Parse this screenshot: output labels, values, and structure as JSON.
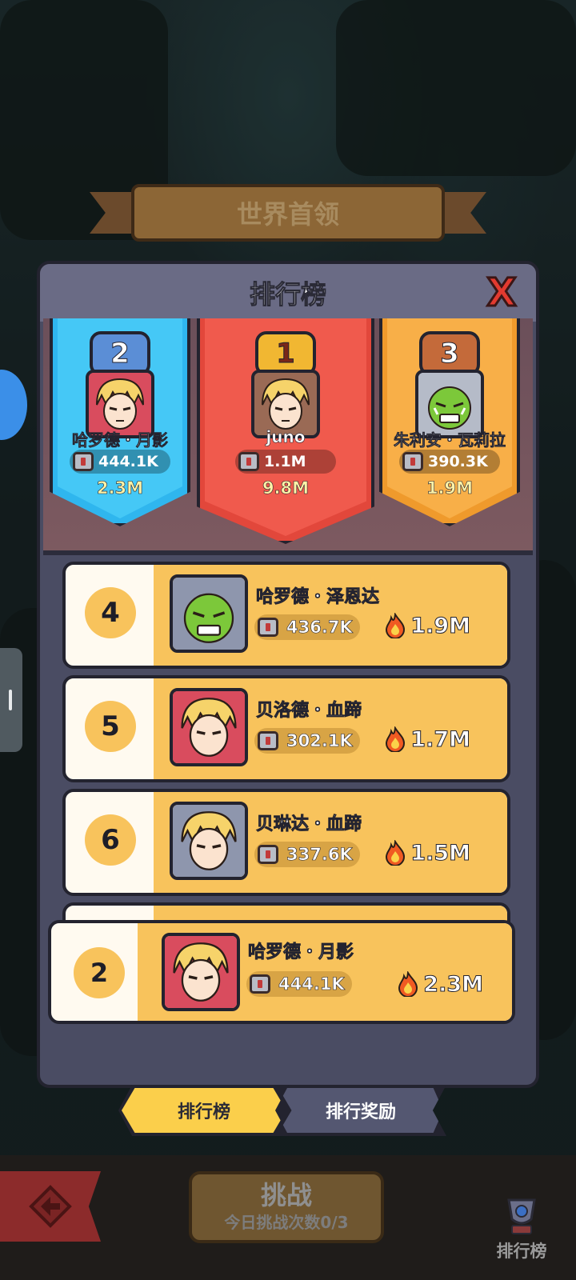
{
  "header": {
    "boss_title": "世界首领"
  },
  "panel": {
    "title": "排行榜",
    "close_label": "X"
  },
  "podium": [
    {
      "rank": "2",
      "name": "哈罗德・月影",
      "power": "444.1K",
      "score": "2.3M",
      "avatar": "blonde-hero",
      "color": "#2fb6ee"
    },
    {
      "rank": "1",
      "name": "juno",
      "power": "1.1M",
      "score": "9.8M",
      "avatar": "blonde-hero",
      "color": "#e2473b"
    },
    {
      "rank": "3",
      "name": "朱利安・瓦莉拉",
      "power": "390.3K",
      "score": "1.9M",
      "avatar": "green-orc",
      "color": "#ef9a2c"
    }
  ],
  "list": [
    {
      "rank": "4",
      "name": "哈罗德・泽恩达",
      "power": "436.7K",
      "score": "1.9M",
      "avatar": "green-orc"
    },
    {
      "rank": "5",
      "name": "贝洛德・血蹄",
      "power": "302.1K",
      "score": "1.7M",
      "avatar": "blonde-hero"
    },
    {
      "rank": "6",
      "name": "贝琳达・血蹄",
      "power": "337.6K",
      "score": "1.5M",
      "avatar": "blonde-hero"
    }
  ],
  "my_rank": {
    "rank": "2",
    "name": "哈罗德・月影",
    "power": "444.1K",
    "score": "2.3M",
    "avatar": "blonde-hero"
  },
  "tabs": [
    {
      "label": "排行榜",
      "active": true
    },
    {
      "label": "排行奖励",
      "active": false
    }
  ],
  "bottom": {
    "challenge_label": "挑战",
    "challenge_sub": "今日挑战次数0/3",
    "rank_nav_label": "排行榜"
  },
  "icons": {
    "power": "chest-icon",
    "score": "flame-icon",
    "close": "close-icon",
    "back": "back-icon"
  }
}
